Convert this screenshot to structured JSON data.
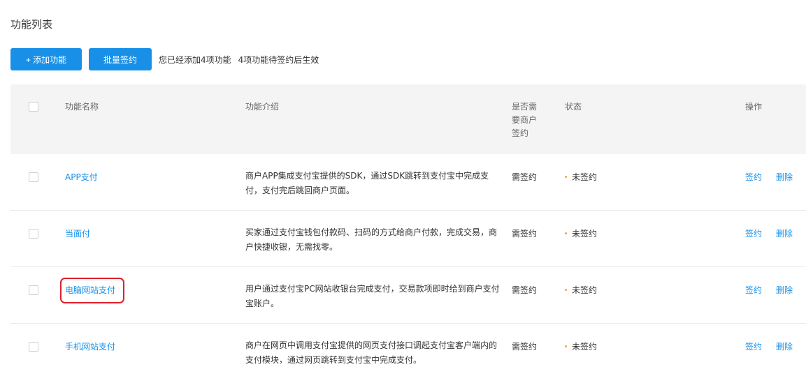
{
  "page": {
    "title": "功能列表"
  },
  "toolbar": {
    "add_label": "+ 添加功能",
    "batch_sign_label": "批量签约",
    "added_info": "您已经添加4项功能",
    "pending_info": "4项功能待签约后生效"
  },
  "table": {
    "headers": {
      "name": "功能名称",
      "description": "功能介绍",
      "needs_sign": "是否需要商户签约",
      "status": "状态",
      "actions": "操作"
    },
    "rows": [
      {
        "name": "APP支付",
        "description": "商户APP集成支付宝提供的SDK，通过SDK跳转到支付宝中完成支付，支付完后跳回商户页面。",
        "needs_sign": "需签约",
        "status": "未签约",
        "sign_label": "签约",
        "delete_label": "删除"
      },
      {
        "name": "当面付",
        "description": "买家通过支付宝钱包付款码、扫码的方式给商户付款，完成交易，商户快捷收银，无需找零。",
        "needs_sign": "需签约",
        "status": "未签约",
        "sign_label": "签约",
        "delete_label": "删除"
      },
      {
        "name": "电脑网站支付",
        "description": "用户通过支付宝PC网站收银台完成支付，交易款项即时给到商户支付宝账户。",
        "needs_sign": "需签约",
        "status": "未签约",
        "sign_label": "签约",
        "delete_label": "删除"
      },
      {
        "name": "手机网站支付",
        "description": "商户在网页中调用支付宝提供的网页支付接口调起支付宝客户端内的支付模块，通过网页跳转到支付宝中完成支付。",
        "needs_sign": "需签约",
        "status": "未签约",
        "sign_label": "签约",
        "delete_label": "删除"
      }
    ]
  },
  "colors": {
    "primary": "#1890e8",
    "status_pending": "#f5a623",
    "highlight": "#e0202a",
    "header_bg": "#f4f4f4"
  }
}
